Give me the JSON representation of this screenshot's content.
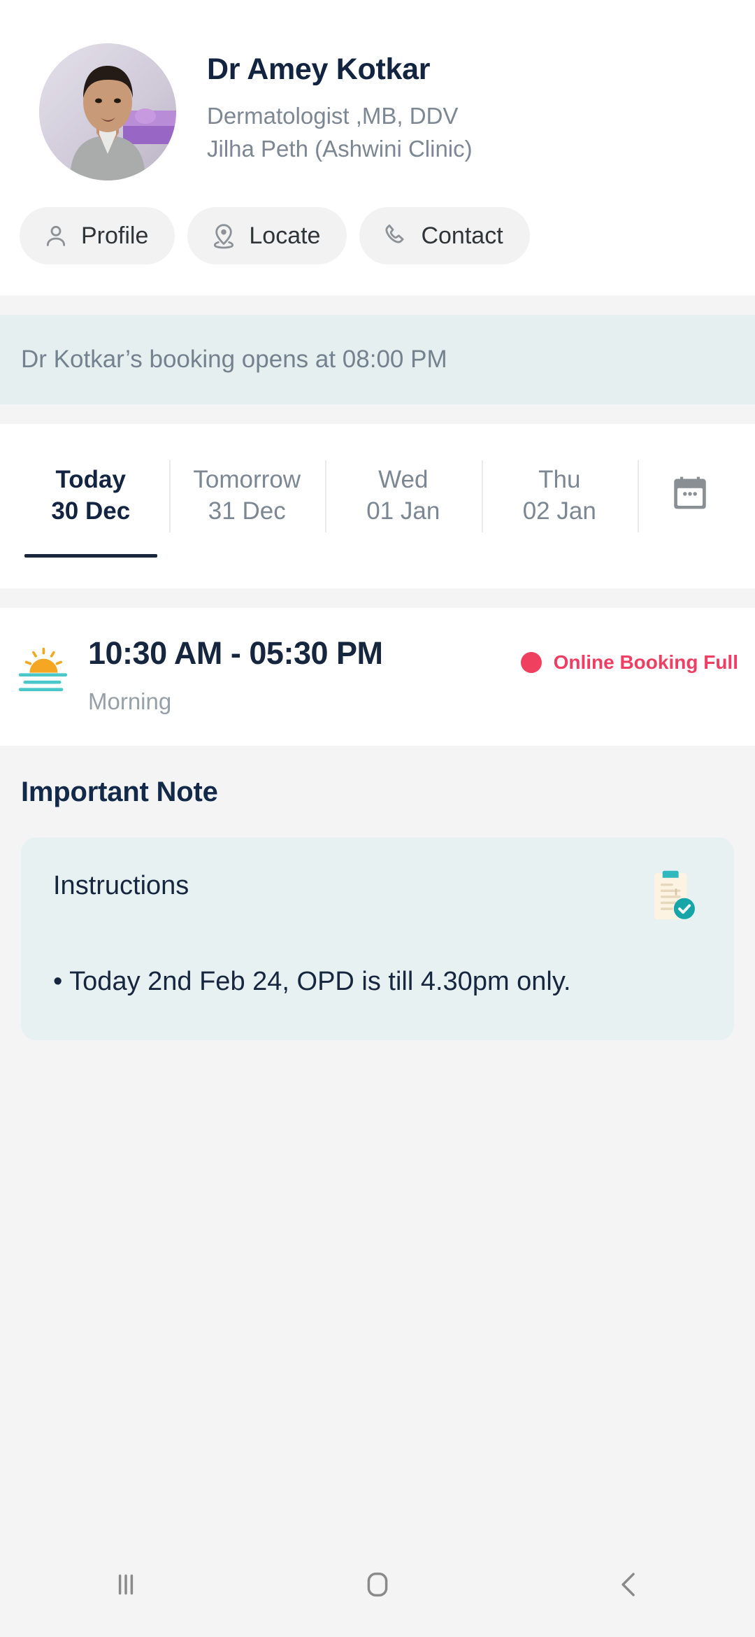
{
  "doctor": {
    "name": "Dr Amey Kotkar",
    "qualification": "Dermatologist ,MB, DDV",
    "clinic": "Jilha Peth (Ashwini Clinic)",
    "avatar_alt": "doctor-photo"
  },
  "actions": [
    {
      "id": "profile",
      "label": "Profile",
      "icon": "person-icon"
    },
    {
      "id": "locate",
      "label": "Locate",
      "icon": "map-pin-icon"
    },
    {
      "id": "contact",
      "label": "Contact",
      "icon": "phone-icon"
    }
  ],
  "banner": {
    "text": "Dr Kotkar’s booking opens at 08:00 PM",
    "bg_color": "#e6eff0",
    "text_color": "#74818f"
  },
  "date_tabs": {
    "items": [
      {
        "day": "Today",
        "date": "30 Dec",
        "active": true
      },
      {
        "day": "Tomorrow",
        "date": "31 Dec",
        "active": false
      },
      {
        "day": "Wed",
        "date": "01 Jan",
        "active": false
      },
      {
        "day": "Thu",
        "date": "02 Jan",
        "active": false
      }
    ],
    "calendar_icon": "calendar-icon"
  },
  "slot": {
    "icon": "sunrise-icon",
    "time_range": "10:30 AM - 05:30 PM",
    "period": "Morning",
    "status_label": "Online Booking Full",
    "status_color": "#ee3e63"
  },
  "note": {
    "section_title": "Important Note",
    "card_title": "Instructions",
    "card_icon": "clipboard-check-icon",
    "body": "• Today 2nd Feb 24, OPD is till 4.30pm only.",
    "bg_color": "#e7f1f2"
  },
  "navbar": {
    "recents_label": "recent-apps",
    "home_label": "home",
    "back_label": "back"
  }
}
